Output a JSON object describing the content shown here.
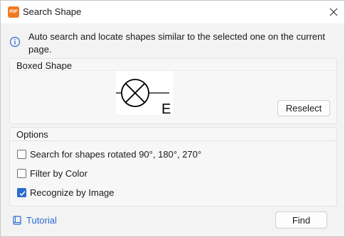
{
  "window": {
    "title": "Search Shape",
    "app_icon_text": "PDF",
    "close_icon": "close-icon",
    "accent_color": "#2a6ccf",
    "brand_color": "#f07a22"
  },
  "info": {
    "icon": "info-icon",
    "text": "Auto search and locate shapes similar to the selected one on the current page."
  },
  "boxed_shape": {
    "title": "Boxed Shape",
    "preview_label": "E",
    "reselect_label": "Reselect"
  },
  "options": {
    "title": "Options",
    "items": [
      {
        "label": "Search for shapes rotated 90°, 180°, 270°",
        "checked": false
      },
      {
        "label": "Filter by Color",
        "checked": false
      },
      {
        "label": "Recognize by Image",
        "checked": true
      }
    ]
  },
  "footer": {
    "tutorial_label": "Tutorial",
    "tutorial_icon": "book-icon",
    "find_label": "Find"
  }
}
